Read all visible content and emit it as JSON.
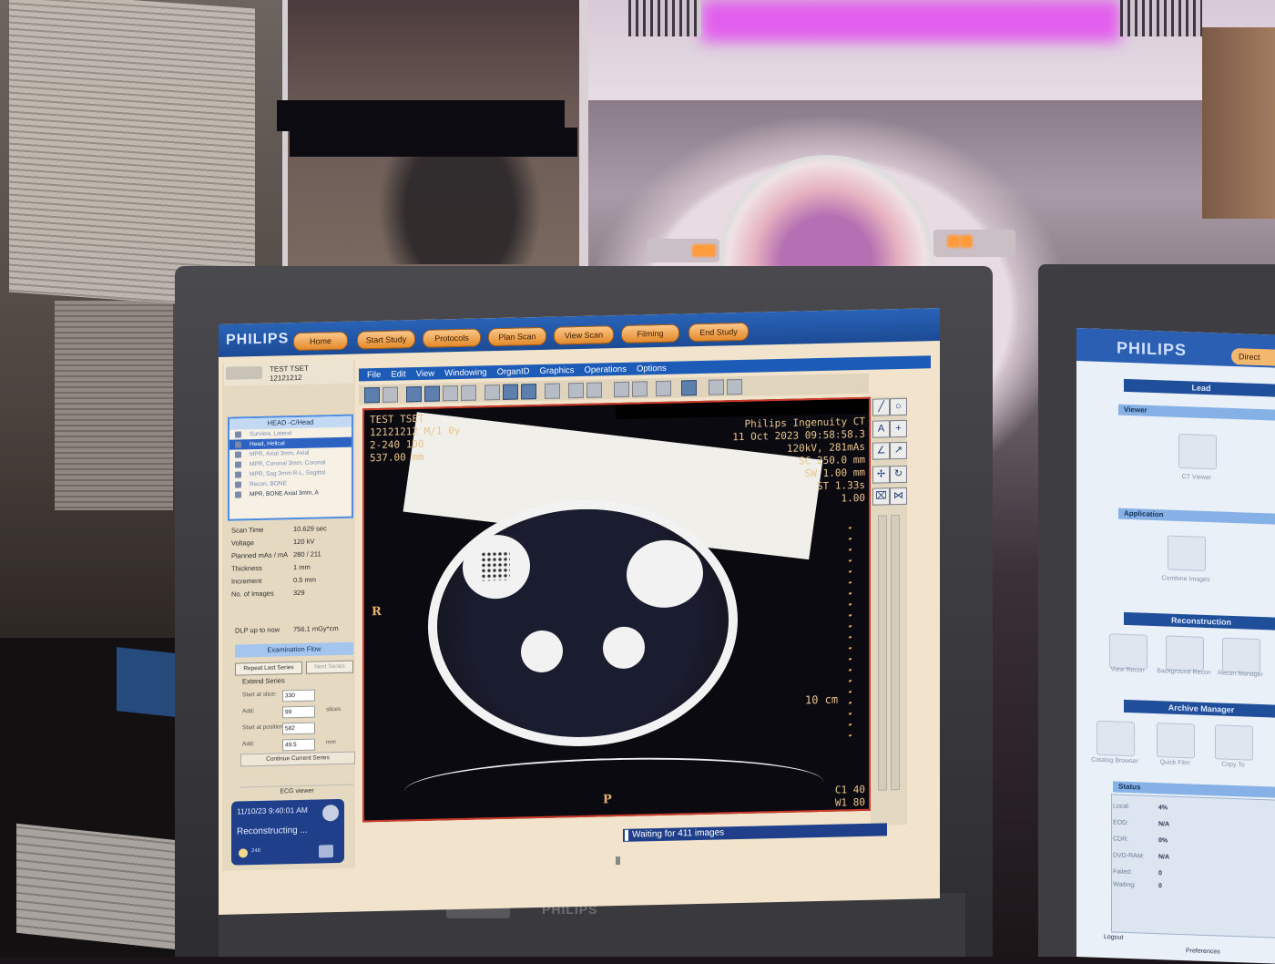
{
  "app": {
    "brand": "PHILIPS",
    "nav_buttons": [
      "Home",
      "Start Study",
      "Protocols",
      "Plan Scan",
      "View Scan",
      "Filming",
      "End Study"
    ]
  },
  "patient": {
    "name": "TEST TSET",
    "id": "12121212"
  },
  "series_list": {
    "header": "HEAD -C/Head",
    "items": [
      {
        "label": "Surview, Lateral",
        "state": "done"
      },
      {
        "label": "Head, Helical",
        "state": "selected"
      },
      {
        "label": "MPR, Axial 3mm, Axial",
        "state": "pending"
      },
      {
        "label": "MPR, Coronal 3mm, Coronal",
        "state": "pending"
      },
      {
        "label": "MPR, Sag 3mm R-L, Sagittal",
        "state": "pending"
      },
      {
        "label": "Recon, BONE",
        "state": "pending"
      },
      {
        "label": "MPR, BONE Axial 3mm, A",
        "state": "sub"
      }
    ]
  },
  "scan_params": [
    {
      "key": "Scan Time",
      "value": "10.629 sec"
    },
    {
      "key": "Voltage",
      "value": "120 kV"
    },
    {
      "key": "Planned mAs / mA",
      "value": "280 / 211"
    },
    {
      "key": "Thickness",
      "value": "1 mm"
    },
    {
      "key": "Increment",
      "value": "0.5 mm"
    },
    {
      "key": "No. of Images",
      "value": "329"
    }
  ],
  "dlp": {
    "label": "DLP up to now",
    "value": "756.1 mGy*cm"
  },
  "exam_flow": {
    "title": "Examination Flow",
    "repeat": "Repeat Last Series",
    "next": "Next Series",
    "extend_label": "Extend Series",
    "fields": [
      {
        "label": "Start at slice:",
        "value": "330",
        "unit": ""
      },
      {
        "label": "Add:",
        "value": "99",
        "unit": "slices"
      },
      {
        "label": "Start at position:",
        "value": "582",
        "unit": ""
      },
      {
        "label": "Add:",
        "value": "49.5",
        "unit": "mm"
      }
    ],
    "continue": "Continue Current Series",
    "ecg": "ECG viewer"
  },
  "status_card": {
    "time": "11/10/23 9:40:01 AM",
    "status": "Reconstructing ...",
    "left_note": "248",
    "right_note": "0"
  },
  "menu": [
    "File",
    "Edit",
    "View",
    "Windowing",
    "OrganID",
    "Graphics",
    "Operations",
    "Options"
  ],
  "viewer": {
    "top_left": [
      "TEST TSET",
      "12121212 M/1 0y",
      "2-240 1D0",
      "537.00 mm"
    ],
    "top_right": [
      "Philips Ingenuity CT",
      "11 Oct 2023 09:58:58.3",
      "120kV, 281mAs",
      "SC 250.0 mm",
      "SW 1.00 mm",
      "ST 1.33s",
      "1.00"
    ],
    "orient_left": "R",
    "orient_bottom": "P",
    "scale_label": "10 cm",
    "window": [
      "C1 40",
      "W1 80"
    ]
  },
  "wait_text": "Waiting for 411 images",
  "right_screen": {
    "brand": "PHILIPS",
    "btn": "Direct",
    "lead": "Lead",
    "viewer": "Viewer",
    "ctviewer": "CT Viewer",
    "application": "Application",
    "combine": "Combine Images",
    "recon": "Reconstruction",
    "recon_items": [
      "View Recon",
      "Background Recon",
      "Recon Manager"
    ],
    "archive": "Archive Manager",
    "archive_items": [
      "Catalog Browser",
      "Quick Film",
      "Copy To"
    ],
    "status": "Status",
    "status_rows": [
      {
        "k": "Local:",
        "v": "4%"
      },
      {
        "k": "EOD:",
        "v": "N/A"
      },
      {
        "k": "CDR:",
        "v": "0%"
      },
      {
        "k": "DVD-RAM:",
        "v": "N/A"
      },
      {
        "k": "Failed:",
        "v": "0"
      },
      {
        "k": "Waiting:",
        "v": "0"
      }
    ],
    "logout": "Logout",
    "preferences": "Preferences"
  }
}
